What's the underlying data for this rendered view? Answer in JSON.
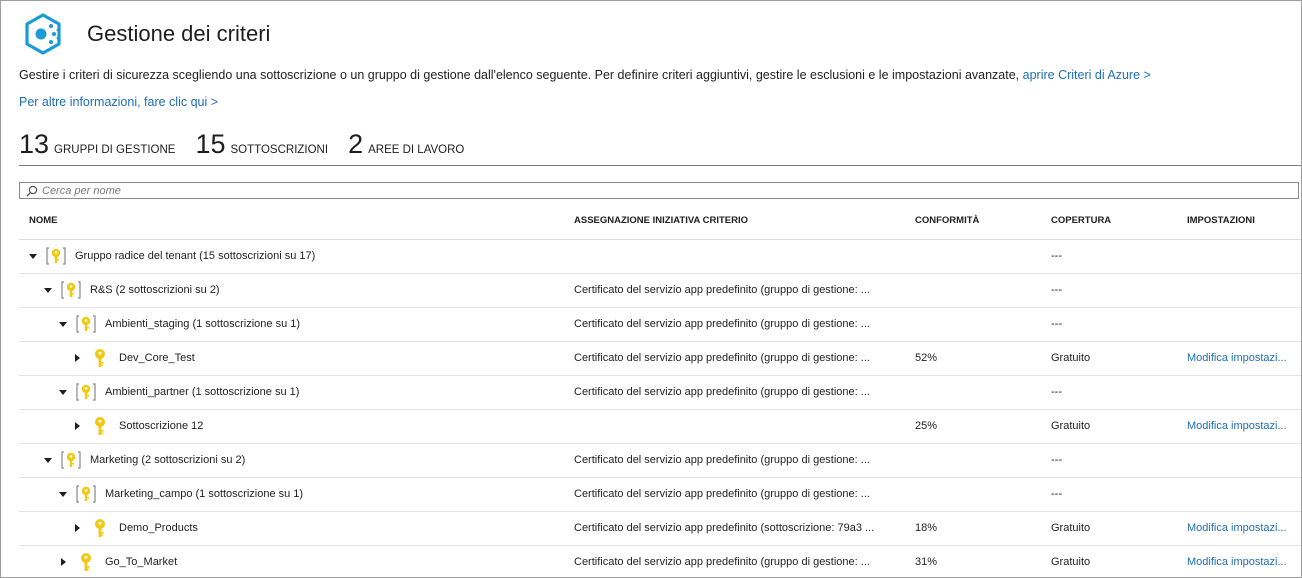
{
  "page": {
    "title": "Gestione dei criteri",
    "description_text": "Gestire i criteri di sicurezza scegliendo una sottoscrizione o un gruppo di gestione dall'elenco seguente. Per definire criteri aggiuntivi, gestire le esclusioni e le impostazioni avanzate,",
    "description_link": "aprire Criteri di Azure >",
    "more_info_link": "Per altre informazioni, fare clic qui >"
  },
  "stats": [
    {
      "count": "13",
      "label": "GRUPPI DI GESTIONE"
    },
    {
      "count": "15",
      "label": "SOTTOSCRIZIONI"
    },
    {
      "count": "2",
      "label": "AREE DI LAVORO"
    }
  ],
  "search": {
    "placeholder": "Cerca per nome",
    "value": ""
  },
  "columns": {
    "name": "NOME",
    "assignment": "ASSEGNAZIONE INIZIATIVA CRITERIO",
    "compliance": "CONFORMITÀ",
    "coverage": "COPERTURA",
    "settings": "IMPOSTAZIONI"
  },
  "rows": [
    {
      "level": 0,
      "expanded": true,
      "type": "management-group",
      "name": "Gruppo radice del tenant (15 sottoscrizioni su 17)",
      "assignment": "",
      "compliance": "",
      "coverage": "---",
      "settings": ""
    },
    {
      "level": 1,
      "expanded": true,
      "type": "management-group",
      "name": "R&S (2 sottoscrizioni su 2)",
      "assignment": "Certificato del servizio app predefinito (gruppo di gestione: ...",
      "compliance": "",
      "coverage": "---",
      "settings": ""
    },
    {
      "level": 2,
      "expanded": true,
      "type": "management-group",
      "name": "Ambienti_staging (1 sottoscrizione su 1)",
      "assignment": "Certificato del servizio app predefinito (gruppo di gestione: ...",
      "compliance": "",
      "coverage": "---",
      "settings": ""
    },
    {
      "level": 3,
      "expanded": false,
      "type": "subscription",
      "name": "Dev_Core_Test",
      "assignment": "Certificato del servizio app predefinito (gruppo di gestione: ...",
      "compliance": "52%",
      "coverage": "Gratuito",
      "settings": "Modifica impostazi..."
    },
    {
      "level": 2,
      "expanded": true,
      "type": "management-group",
      "name": "Ambienti_partner (1 sottoscrizione su 1)",
      "assignment": "Certificato del servizio app predefinito (gruppo di gestione: ...",
      "compliance": "",
      "coverage": "---",
      "settings": ""
    },
    {
      "level": 3,
      "expanded": false,
      "type": "subscription",
      "name": "Sottoscrizione 12",
      "assignment": "",
      "compliance": "25%",
      "coverage": "Gratuito",
      "settings": "Modifica impostazi..."
    },
    {
      "level": 1,
      "expanded": true,
      "type": "management-group",
      "name": "Marketing (2 sottoscrizioni su 2)",
      "assignment": "Certificato del servizio app predefinito (gruppo di gestione: ...",
      "compliance": "",
      "coverage": "---",
      "settings": ""
    },
    {
      "level": 2,
      "expanded": true,
      "type": "management-group",
      "name": "Marketing_campo (1 sottoscrizione su 1)",
      "assignment": "Certificato del servizio app predefinito (gruppo di gestione: ...",
      "compliance": "",
      "coverage": "---",
      "settings": ""
    },
    {
      "level": 3,
      "expanded": false,
      "type": "subscription",
      "name": "Demo_Products",
      "assignment": "Certificato del servizio app predefinito (sottoscrizione: 79a3 ...",
      "compliance": "18%",
      "coverage": "Gratuito",
      "settings": "Modifica impostazi..."
    },
    {
      "level": 2,
      "expanded": false,
      "type": "subscription",
      "name": "Go_To_Market",
      "assignment": "Certificato del servizio app predefinito (gruppo di gestione: ...",
      "compliance": "31%",
      "coverage": "Gratuito",
      "settings": "Modifica impostazi..."
    }
  ],
  "colors": {
    "link": "#1f6fb8",
    "key_icon": "#f2c811",
    "logo": "#1a9bd7"
  }
}
